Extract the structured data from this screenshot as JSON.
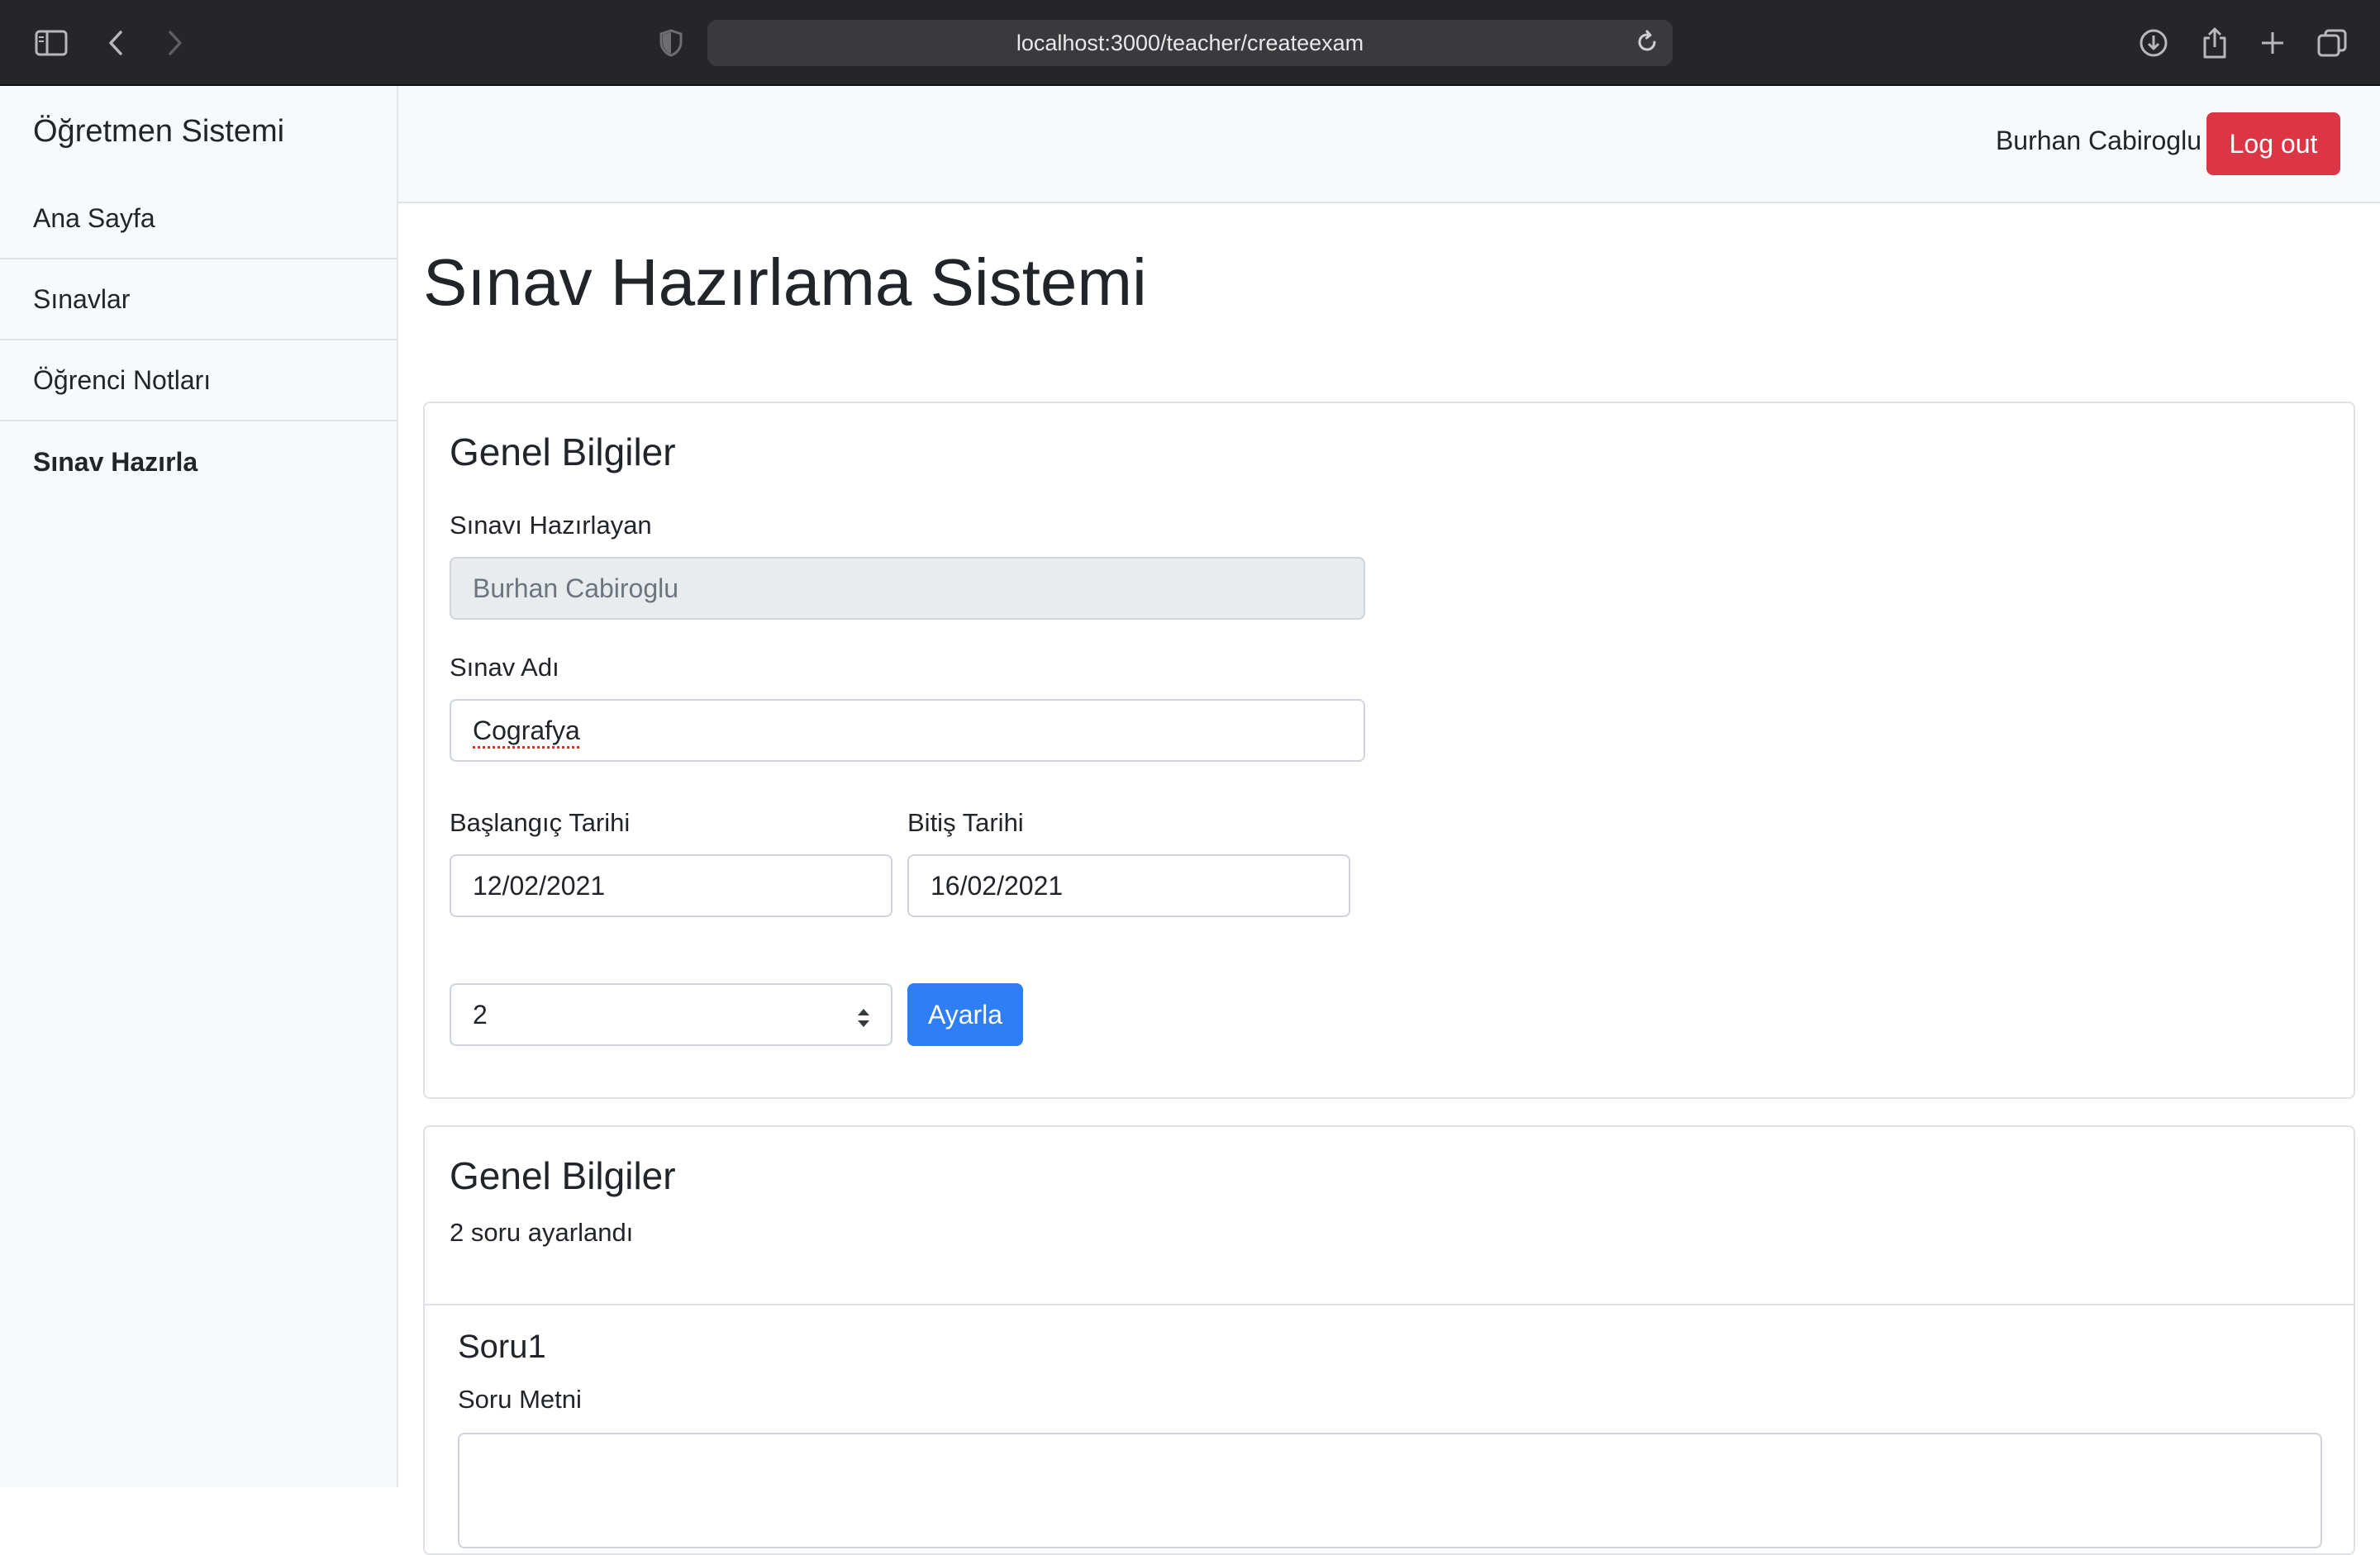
{
  "browser": {
    "url": "localhost:3000/teacher/createexam"
  },
  "sidebar": {
    "brand": "Öğretmen Sistemi",
    "items": [
      {
        "label": "Ana Sayfa"
      },
      {
        "label": "Sınavlar"
      },
      {
        "label": "Öğrenci Notları"
      },
      {
        "label": "Sınav Hazırla"
      }
    ]
  },
  "topbar": {
    "user_name": "Burhan Cabiroglu",
    "logout_label": "Log out"
  },
  "main": {
    "title": "Sınav Hazırlama Sistemi",
    "general_card": {
      "title": "Genel Bilgiler",
      "preparer_label": "Sınavı Hazırlayan",
      "preparer_value": "Burhan Cabiroglu",
      "exam_name_label": "Sınav Adı",
      "exam_name_value": "Cografya",
      "start_label": "Başlangıç Tarihi",
      "start_value": "12/02/2021",
      "end_label": "Bitiş Tarihi",
      "end_value": "16/02/2021",
      "question_count_value": "2",
      "set_button": "Ayarla"
    },
    "questions_card": {
      "title": "Genel Bilgiler",
      "status": "2 soru ayarlandı",
      "question1_title": "Soru1",
      "question1_text_label": "Soru Metni"
    }
  },
  "colors": {
    "logout": "#dc3545",
    "primary": "#2f7ef5",
    "chrome": "#262628"
  }
}
